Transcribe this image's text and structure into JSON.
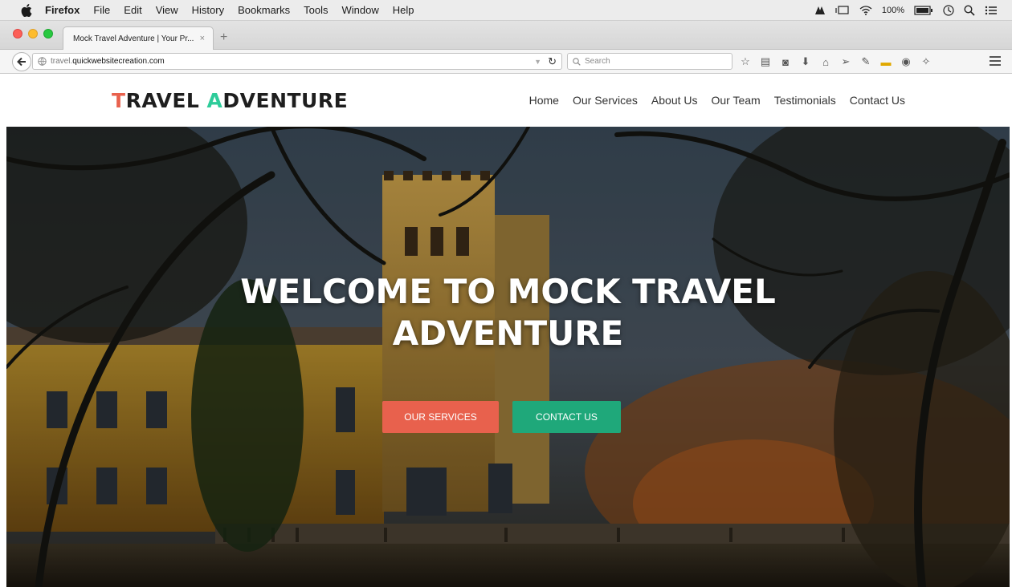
{
  "os_menubar": {
    "app_name": "Firefox",
    "menus": [
      "File",
      "Edit",
      "View",
      "History",
      "Bookmarks",
      "Tools",
      "Window",
      "Help"
    ],
    "battery_text": "100%"
  },
  "browser": {
    "tab_title": "Mock Travel Adventure | Your Pr...",
    "tab_close": "×",
    "new_tab": "+",
    "url_subdomain": "travel.",
    "url_domain": "quickwebsitecreation.com",
    "search_placeholder": "Search"
  },
  "site": {
    "logo": {
      "first_letter_1": "T",
      "rest_1": "RAVEL ",
      "first_letter_2": "A",
      "rest_2": "DVENTURE"
    },
    "nav": [
      "Home",
      "Our Services",
      "About Us",
      "Our Team",
      "Testimonials",
      "Contact Us"
    ],
    "hero": {
      "title_line1": "WELCOME TO MOCK TRAVEL",
      "title_line2": "ADVENTURE",
      "btn_services": "OUR SERVICES",
      "btn_contact": "CONTACT US"
    }
  },
  "colors": {
    "accent_red": "#e8614d",
    "accent_green": "#2ecc9a",
    "button_green": "#1fa87a"
  }
}
